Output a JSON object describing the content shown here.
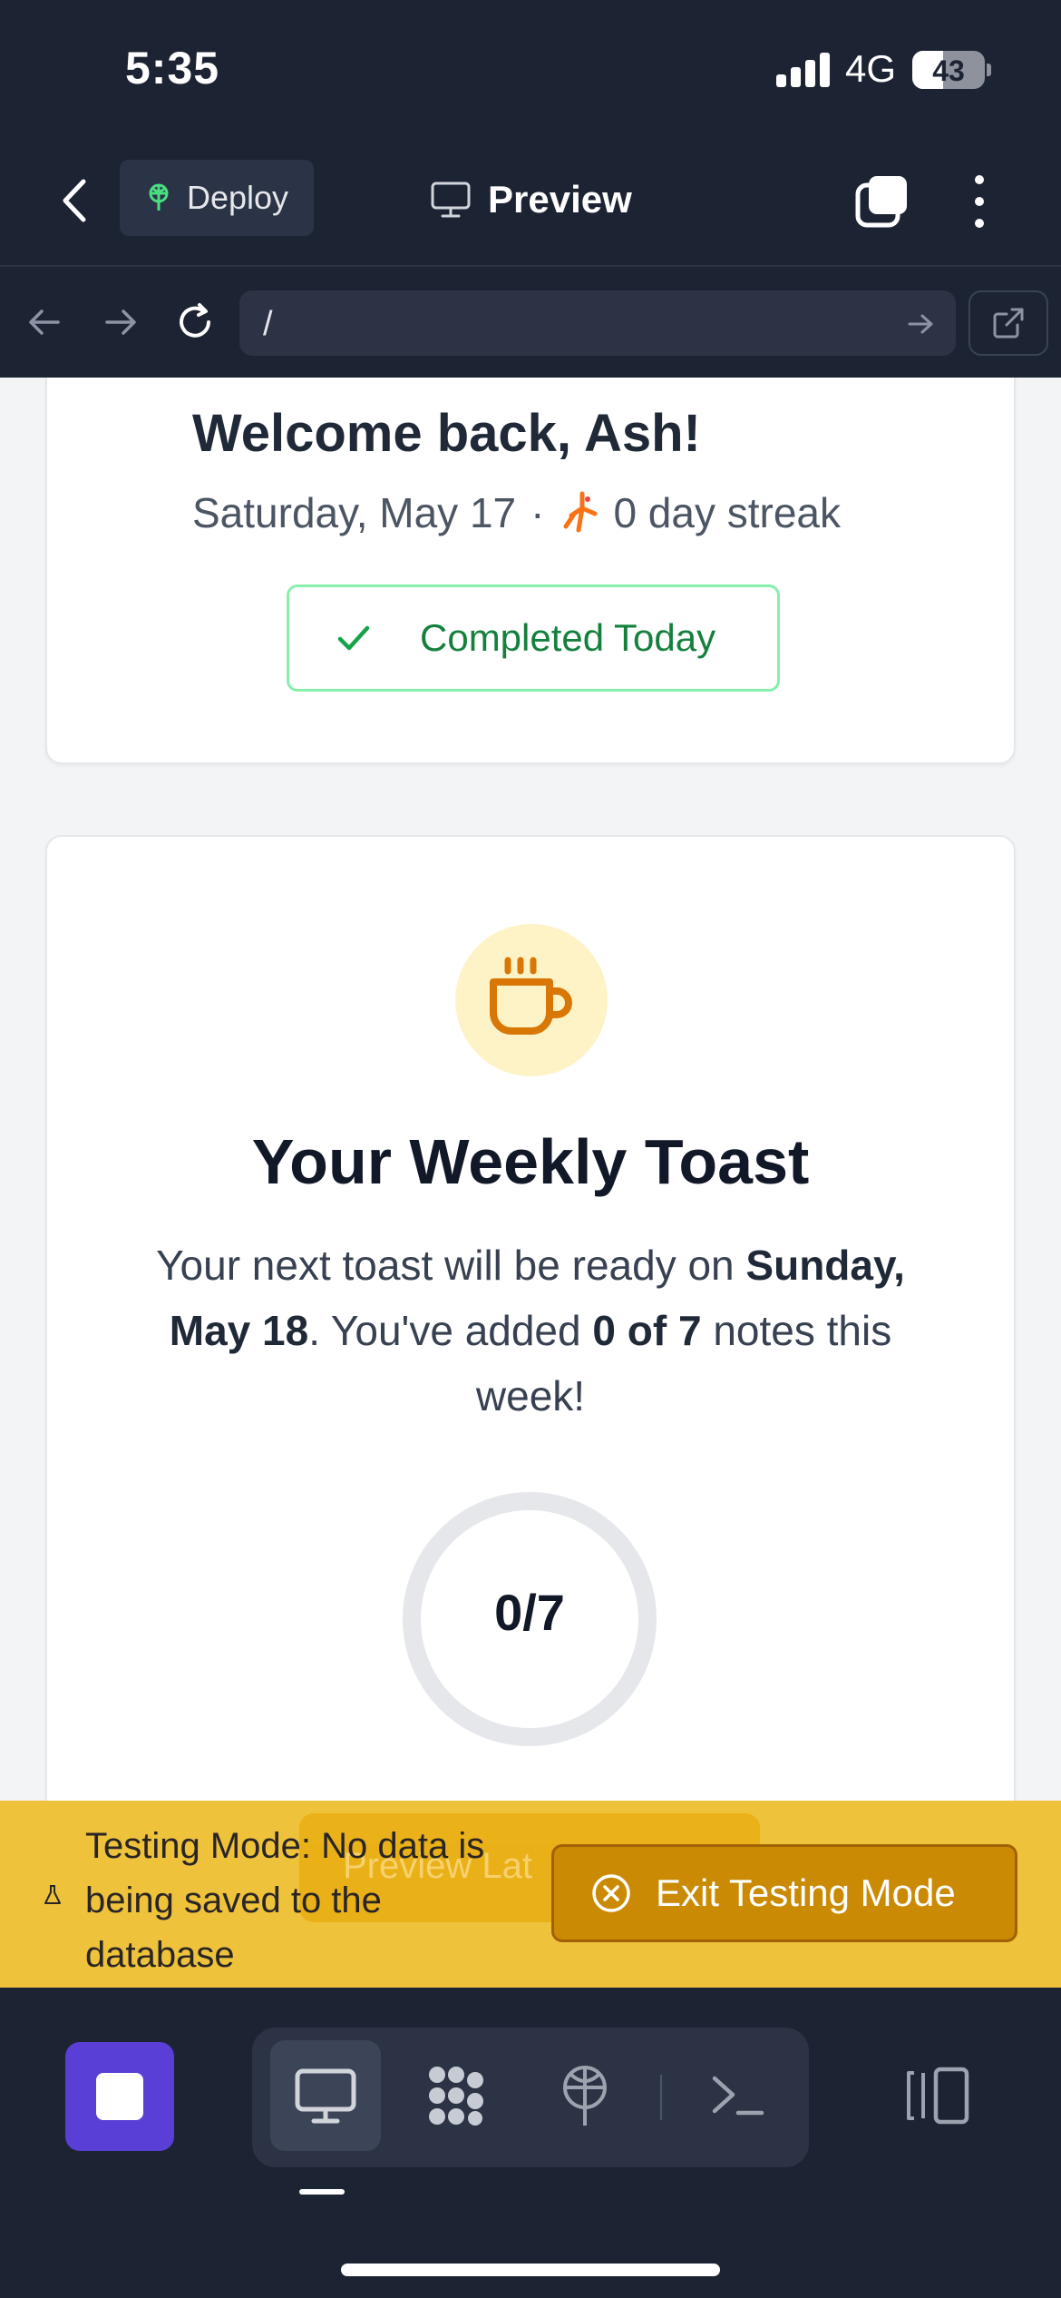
{
  "status_bar": {
    "time": "5:35",
    "network": "4G",
    "battery": "43"
  },
  "header": {
    "deploy_label": "Deploy",
    "title": "Preview"
  },
  "url_bar": {
    "url": "/"
  },
  "welcome_card": {
    "greeting": "Welcome back, Ash!",
    "date": "Saturday, May 17",
    "separator": "·",
    "streak": "0 day streak",
    "completed_label": "Completed Today"
  },
  "toast_card": {
    "title": "Your Weekly Toast",
    "text_1": "Your next toast will be ready on ",
    "ready_date": "Sunday, May 18",
    "text_2": ". You've added ",
    "notes_count": "0 of 7",
    "text_3": " notes this week!",
    "progress_label": "0/7",
    "progress_fraction": 0
  },
  "testing_banner": {
    "message": "Testing Mode: No data is being saved to the database",
    "hidden_button_label": "Preview Lat",
    "exit_label": "Exit Testing Mode"
  },
  "colors": {
    "dark_bg": "#1c2333",
    "accent_purple": "#5a3fd6",
    "success_green": "#15803d",
    "banner_yellow": "#efc23c",
    "exit_button": "#ca8a04",
    "cup_orange": "#d97706"
  },
  "icons": {
    "header": [
      "back-icon",
      "deploy-icon",
      "monitor-icon",
      "tabs-icon",
      "more-icon"
    ],
    "url_bar": [
      "arrow-left-icon",
      "arrow-right-icon",
      "reload-icon",
      "go-icon",
      "external-link-icon"
    ],
    "toolbar": [
      "stop-icon",
      "monitor-icon",
      "workspace-icon",
      "deploy-icon",
      "terminal-icon",
      "split-view-icon"
    ]
  }
}
